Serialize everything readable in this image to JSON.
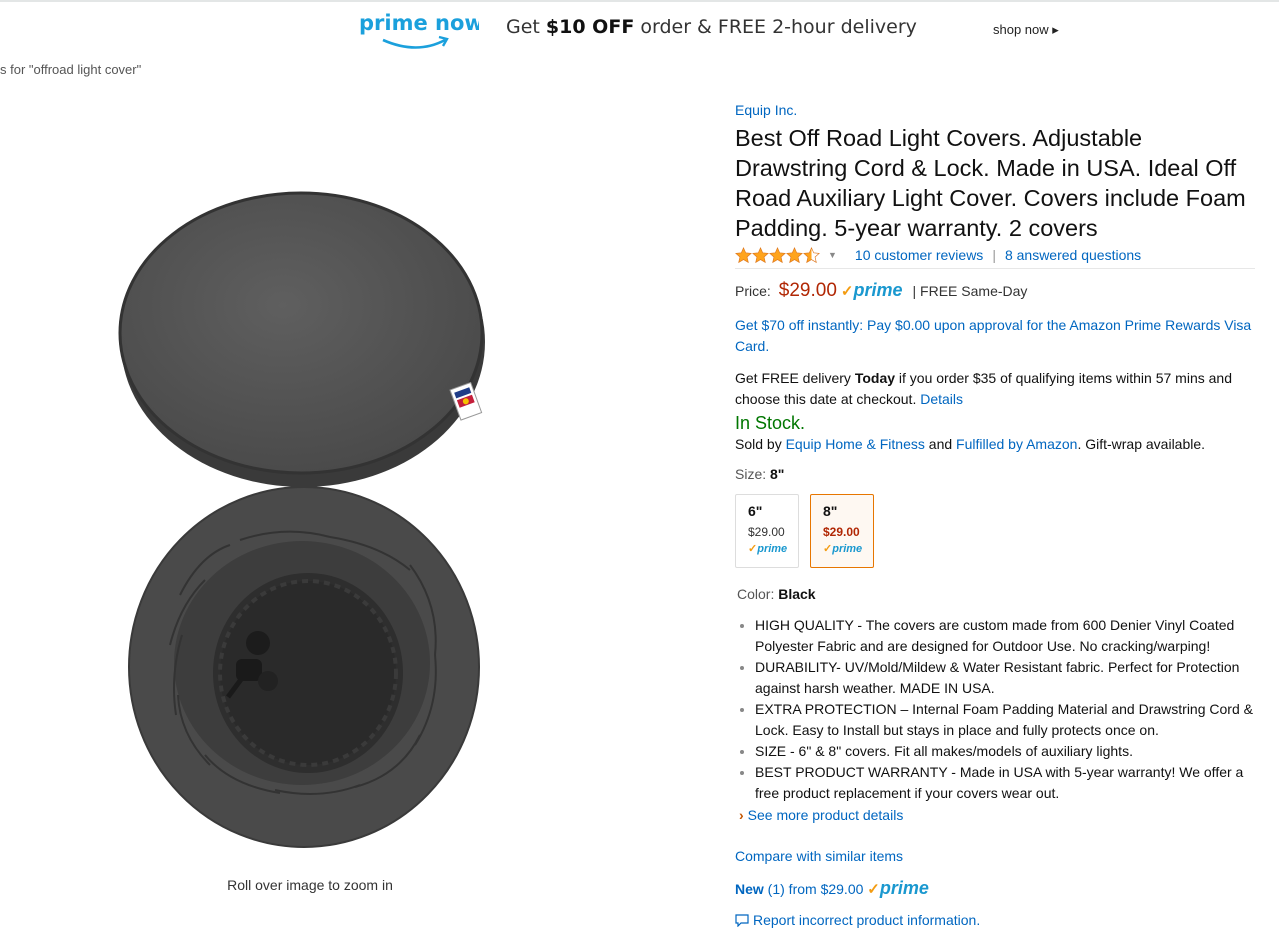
{
  "banner": {
    "logo_text": "prime now",
    "msg_prefix": "Get ",
    "msg_offer": "$10 OFF",
    "msg_suffix": " order & FREE 2-hour delivery",
    "shop_now": "shop now ▸"
  },
  "breadcrumb": "s for \"offroad light cover\"",
  "image_hint": "Roll over image to zoom in",
  "product": {
    "brand": "Equip Inc.",
    "title": "Best Off Road Light Covers. Adjustable Drawstring Cord & Lock. Made in USA. Ideal Off Road Auxiliary Light Cover. Covers include Foam Padding. 5-year warranty. 2 covers",
    "rating": 4.5,
    "reviews": "10 customer reviews",
    "separator": "|",
    "answered": "8 answered questions",
    "price_label": "Price:",
    "price": "$29.00",
    "prime_check": "✓",
    "prime_word": "prime",
    "free_sameday": "| FREE Same-Day",
    "promo": "Get $70 off instantly: Pay $0.00 upon approval for the Amazon Prime Rewards Visa Card.",
    "delivery_a": "Get FREE delivery ",
    "delivery_today": "Today",
    "delivery_b": " if you order $35 of qualifying items within 57 mins and choose this date at checkout. ",
    "delivery_details": "Details",
    "stock": "In Stock.",
    "sold_by_a": "Sold by ",
    "seller": "Equip Home & Fitness",
    "sold_by_b": " and ",
    "fulfilled": "Fulfilled by Amazon",
    "sold_by_c": ". Gift-wrap available.",
    "size_label": "Size: ",
    "size_value": "8\"",
    "sizes": [
      {
        "size": "6\"",
        "price": "$29.00",
        "prime": "prime"
      },
      {
        "size": "8\"",
        "price": "$29.00",
        "prime": "prime"
      }
    ],
    "color_label": "Color: ",
    "color_value": "Black",
    "bullets": [
      "HIGH QUALITY - The covers are custom made from 600 Denier Vinyl Coated Polyester Fabric and are designed for Outdoor Use. No cracking/warping!",
      "DURABILITY- UV/Mold/Mildew & Water Resistant fabric. Perfect for Protection against harsh weather. MADE IN USA.",
      "EXTRA PROTECTION – Internal Foam Padding Material and Drawstring Cord & Lock. Easy to Install but stays in place and fully protects once on.",
      "SIZE - 6\" & 8\" covers. Fit all makes/models of auxiliary lights.",
      "BEST PRODUCT WARRANTY - Made in USA with 5-year warranty! We offer a free product replacement if your covers wear out."
    ],
    "see_more": "See more product details",
    "compare": "Compare with similar items",
    "new_label": "New",
    "new_rest": " (1) from $29.00 ",
    "report": "Report incorrect product information."
  },
  "colors": {
    "link": "#0066c0",
    "price": "#b12704",
    "stock": "#007600",
    "prime_blue": "#1a98cf",
    "prime_check": "#f39c12",
    "selected_border": "#e77600"
  }
}
